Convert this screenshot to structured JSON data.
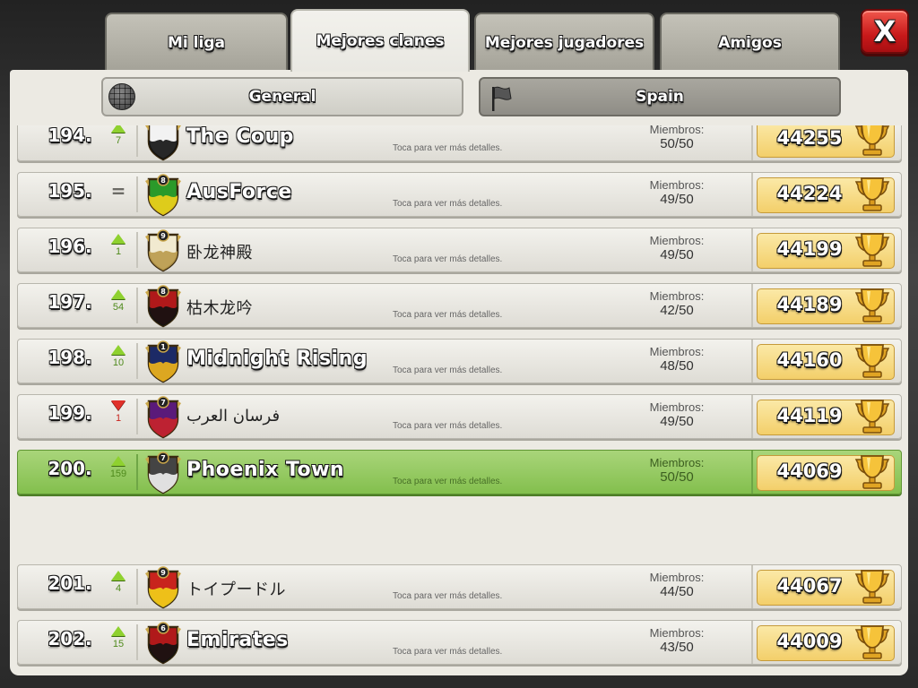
{
  "tabs": [
    {
      "label": "Mi liga",
      "active": false
    },
    {
      "label": "Mejores clanes",
      "active": true
    },
    {
      "label": "Mejores jugadores",
      "active": false
    },
    {
      "label": "Amigos",
      "active": false
    }
  ],
  "close_label": "X",
  "filters": {
    "general": "General",
    "location": "Spain"
  },
  "labels": {
    "members": "Miembros:",
    "tap_hint": "Toca para ver más detalles."
  },
  "colors": {
    "highlight": "#8cc45a",
    "trend_up": "#8fd12f",
    "trend_down": "#e0312a",
    "close_red": "#d0231f"
  },
  "clans": [
    {
      "rank": "194.",
      "trend": "up",
      "trend_value": "7",
      "name": "The Coup",
      "members": "50/50",
      "trophies": "44255",
      "badge_icon": "checkered-shield-icon",
      "latin": true
    },
    {
      "rank": "195.",
      "trend": "same",
      "trend_value": "=",
      "name": "AusForce",
      "members": "49/50",
      "trophies": "44224",
      "badge_icon": "green-yellow-shield-icon",
      "latin": true
    },
    {
      "rank": "196.",
      "trend": "up",
      "trend_value": "1",
      "name": "卧龙神殿",
      "members": "49/50",
      "trophies": "44199",
      "badge_icon": "cream-shield-icon",
      "latin": false
    },
    {
      "rank": "197.",
      "trend": "up",
      "trend_value": "54",
      "name": "枯木龙吟",
      "members": "42/50",
      "trophies": "44189",
      "badge_icon": "red-black-shield-icon",
      "latin": false
    },
    {
      "rank": "198.",
      "trend": "up",
      "trend_value": "10",
      "name": "Midnight Rising",
      "members": "48/50",
      "trophies": "44160",
      "badge_icon": "blue-flame-shield-icon",
      "latin": true
    },
    {
      "rank": "199.",
      "trend": "down",
      "trend_value": "1",
      "name": "فرسان العرب",
      "members": "49/50",
      "trophies": "44119",
      "badge_icon": "purple-checkered-shield-icon",
      "latin": false
    },
    {
      "rank": "200.",
      "trend": "up",
      "trend_value": "159",
      "name": "Phoenix Town",
      "members": "50/50",
      "trophies": "44069",
      "badge_icon": "phoenix-shield-icon",
      "latin": true,
      "highlight": true
    },
    {
      "rank": "201.",
      "trend": "up",
      "trend_value": "4",
      "name": "トイプードル",
      "members": "44/50",
      "trophies": "44067",
      "badge_icon": "red-cross-shield-icon",
      "latin": false
    },
    {
      "rank": "202.",
      "trend": "up",
      "trend_value": "15",
      "name": "Emirates",
      "members": "43/50",
      "trophies": "44009",
      "badge_icon": "red-black-shield-icon",
      "latin": true
    }
  ],
  "badge_levels": [
    "",
    "8",
    "9",
    "8",
    "1",
    "7",
    "7",
    "9",
    "6"
  ]
}
